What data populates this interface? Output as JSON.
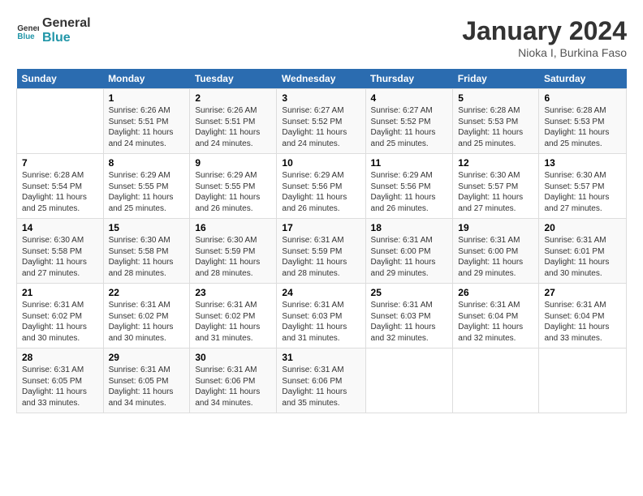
{
  "logo": {
    "line1": "General",
    "line2": "Blue"
  },
  "title": "January 2024",
  "subtitle": "Nioka I, Burkina Faso",
  "days_of_week": [
    "Sunday",
    "Monday",
    "Tuesday",
    "Wednesday",
    "Thursday",
    "Friday",
    "Saturday"
  ],
  "weeks": [
    [
      {
        "day": "",
        "info": ""
      },
      {
        "day": "1",
        "info": "Sunrise: 6:26 AM\nSunset: 5:51 PM\nDaylight: 11 hours\nand 24 minutes."
      },
      {
        "day": "2",
        "info": "Sunrise: 6:26 AM\nSunset: 5:51 PM\nDaylight: 11 hours\nand 24 minutes."
      },
      {
        "day": "3",
        "info": "Sunrise: 6:27 AM\nSunset: 5:52 PM\nDaylight: 11 hours\nand 24 minutes."
      },
      {
        "day": "4",
        "info": "Sunrise: 6:27 AM\nSunset: 5:52 PM\nDaylight: 11 hours\nand 25 minutes."
      },
      {
        "day": "5",
        "info": "Sunrise: 6:28 AM\nSunset: 5:53 PM\nDaylight: 11 hours\nand 25 minutes."
      },
      {
        "day": "6",
        "info": "Sunrise: 6:28 AM\nSunset: 5:53 PM\nDaylight: 11 hours\nand 25 minutes."
      }
    ],
    [
      {
        "day": "7",
        "info": "Sunrise: 6:28 AM\nSunset: 5:54 PM\nDaylight: 11 hours\nand 25 minutes."
      },
      {
        "day": "8",
        "info": "Sunrise: 6:29 AM\nSunset: 5:55 PM\nDaylight: 11 hours\nand 25 minutes."
      },
      {
        "day": "9",
        "info": "Sunrise: 6:29 AM\nSunset: 5:55 PM\nDaylight: 11 hours\nand 26 minutes."
      },
      {
        "day": "10",
        "info": "Sunrise: 6:29 AM\nSunset: 5:56 PM\nDaylight: 11 hours\nand 26 minutes."
      },
      {
        "day": "11",
        "info": "Sunrise: 6:29 AM\nSunset: 5:56 PM\nDaylight: 11 hours\nand 26 minutes."
      },
      {
        "day": "12",
        "info": "Sunrise: 6:30 AM\nSunset: 5:57 PM\nDaylight: 11 hours\nand 27 minutes."
      },
      {
        "day": "13",
        "info": "Sunrise: 6:30 AM\nSunset: 5:57 PM\nDaylight: 11 hours\nand 27 minutes."
      }
    ],
    [
      {
        "day": "14",
        "info": "Sunrise: 6:30 AM\nSunset: 5:58 PM\nDaylight: 11 hours\nand 27 minutes."
      },
      {
        "day": "15",
        "info": "Sunrise: 6:30 AM\nSunset: 5:58 PM\nDaylight: 11 hours\nand 28 minutes."
      },
      {
        "day": "16",
        "info": "Sunrise: 6:30 AM\nSunset: 5:59 PM\nDaylight: 11 hours\nand 28 minutes."
      },
      {
        "day": "17",
        "info": "Sunrise: 6:31 AM\nSunset: 5:59 PM\nDaylight: 11 hours\nand 28 minutes."
      },
      {
        "day": "18",
        "info": "Sunrise: 6:31 AM\nSunset: 6:00 PM\nDaylight: 11 hours\nand 29 minutes."
      },
      {
        "day": "19",
        "info": "Sunrise: 6:31 AM\nSunset: 6:00 PM\nDaylight: 11 hours\nand 29 minutes."
      },
      {
        "day": "20",
        "info": "Sunrise: 6:31 AM\nSunset: 6:01 PM\nDaylight: 11 hours\nand 30 minutes."
      }
    ],
    [
      {
        "day": "21",
        "info": "Sunrise: 6:31 AM\nSunset: 6:02 PM\nDaylight: 11 hours\nand 30 minutes."
      },
      {
        "day": "22",
        "info": "Sunrise: 6:31 AM\nSunset: 6:02 PM\nDaylight: 11 hours\nand 30 minutes."
      },
      {
        "day": "23",
        "info": "Sunrise: 6:31 AM\nSunset: 6:02 PM\nDaylight: 11 hours\nand 31 minutes."
      },
      {
        "day": "24",
        "info": "Sunrise: 6:31 AM\nSunset: 6:03 PM\nDaylight: 11 hours\nand 31 minutes."
      },
      {
        "day": "25",
        "info": "Sunrise: 6:31 AM\nSunset: 6:03 PM\nDaylight: 11 hours\nand 32 minutes."
      },
      {
        "day": "26",
        "info": "Sunrise: 6:31 AM\nSunset: 6:04 PM\nDaylight: 11 hours\nand 32 minutes."
      },
      {
        "day": "27",
        "info": "Sunrise: 6:31 AM\nSunset: 6:04 PM\nDaylight: 11 hours\nand 33 minutes."
      }
    ],
    [
      {
        "day": "28",
        "info": "Sunrise: 6:31 AM\nSunset: 6:05 PM\nDaylight: 11 hours\nand 33 minutes."
      },
      {
        "day": "29",
        "info": "Sunrise: 6:31 AM\nSunset: 6:05 PM\nDaylight: 11 hours\nand 34 minutes."
      },
      {
        "day": "30",
        "info": "Sunrise: 6:31 AM\nSunset: 6:06 PM\nDaylight: 11 hours\nand 34 minutes."
      },
      {
        "day": "31",
        "info": "Sunrise: 6:31 AM\nSunset: 6:06 PM\nDaylight: 11 hours\nand 35 minutes."
      },
      {
        "day": "",
        "info": ""
      },
      {
        "day": "",
        "info": ""
      },
      {
        "day": "",
        "info": ""
      }
    ]
  ]
}
